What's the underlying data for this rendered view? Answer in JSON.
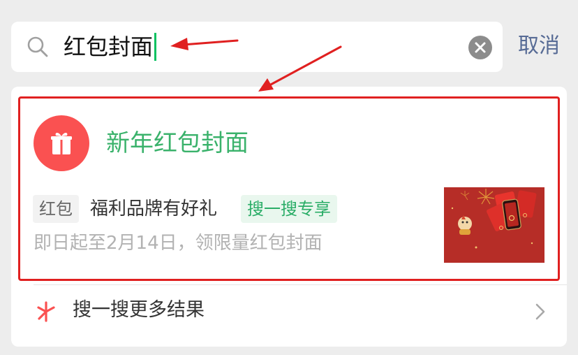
{
  "search": {
    "query": "红包封面",
    "cancel_label": "取消"
  },
  "result": {
    "title": "新年红包封面",
    "tag": "红包",
    "brand_text": "福利品牌有好礼",
    "exclusive_tag": "搜一搜专享",
    "description": "即日起至2月14日，领限量红包封面"
  },
  "more": {
    "label": "搜一搜更多结果"
  },
  "colors": {
    "background": "#ededed",
    "accent_green": "#07c160",
    "title_green": "#3ab26b",
    "link_blue": "#576b95",
    "gift_red": "#fa5151",
    "highlight_red": "#e02020"
  },
  "icons": {
    "search": "search-icon",
    "clear": "clear-icon",
    "gift": "gift-icon",
    "sparkle": "sparkle-icon",
    "chevron": "chevron-right-icon"
  }
}
